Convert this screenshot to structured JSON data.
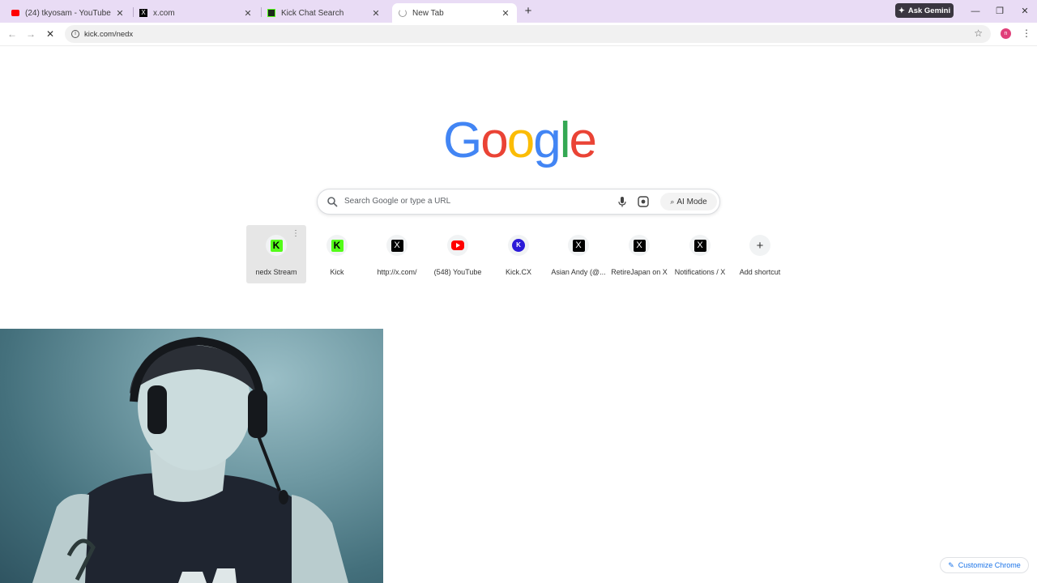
{
  "tabs": [
    {
      "title": "(24) tkyosam - YouTube",
      "favicon": "youtube-icon"
    },
    {
      "title": "x.com",
      "favicon": "x-icon"
    },
    {
      "title": "Kick Chat Search",
      "favicon": "kick-icon"
    },
    {
      "title": "New Tab",
      "favicon": "loading-spinner-icon",
      "active": true
    }
  ],
  "gemini": {
    "label": "Ask Gemini"
  },
  "omnibox": {
    "url": "kick.com/nedx"
  },
  "profile": {
    "initial": "n",
    "color": "#e0407a"
  },
  "logo": {
    "letters": [
      "G",
      "o",
      "o",
      "g",
      "l",
      "e"
    ],
    "colors": [
      "#4285f4",
      "#ea4335",
      "#fbbc05",
      "#4285f4",
      "#34a853",
      "#ea4335"
    ]
  },
  "search": {
    "placeholder": "Search Google or type a URL",
    "ai_mode_label": "AI Mode"
  },
  "shortcuts": [
    {
      "label": "nedx Stream",
      "icon": "kick-icon"
    },
    {
      "label": "Kick",
      "icon": "kick-icon"
    },
    {
      "label": "http://x.com/",
      "icon": "x-icon"
    },
    {
      "label": "(548) YouTube",
      "icon": "youtube-icon"
    },
    {
      "label": "Kick.CX",
      "icon": "kickcx-icon"
    },
    {
      "label": "Asian Andy (@...",
      "icon": "x-icon"
    },
    {
      "label": "RetireJapan on X",
      "icon": "x-icon"
    },
    {
      "label": "Notifications / X",
      "icon": "x-icon"
    },
    {
      "label": "Add shortcut",
      "icon": "plus-icon"
    }
  ],
  "customize": {
    "label": "Customize Chrome"
  }
}
